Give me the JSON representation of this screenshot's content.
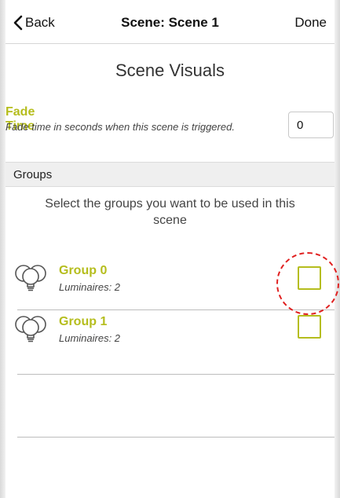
{
  "nav": {
    "back_label": "Back",
    "title": "Scene: Scene 1",
    "done_label": "Done"
  },
  "section_title": "Scene Visuals",
  "fade_time": {
    "title": "Fade Time",
    "description": "Fade time in seconds when this scene is triggered.",
    "value": "0"
  },
  "groups_header": "Groups",
  "groups_instruction": "Select the groups you want to be used in this scene",
  "groups": [
    {
      "name": "Group 0",
      "subtitle": "Luminaires: 2",
      "checked": false,
      "icon": "bulbs-icon"
    },
    {
      "name": "Group 1",
      "subtitle": "Luminaires: 2",
      "checked": false,
      "icon": "bulbs-icon"
    }
  ],
  "colors": {
    "accent": "#b5bd1d",
    "highlight": "#e02020"
  }
}
